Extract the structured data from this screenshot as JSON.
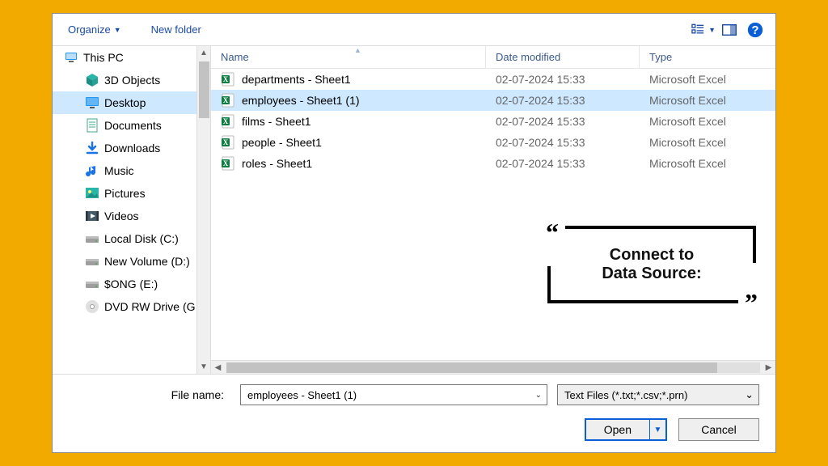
{
  "toolbar": {
    "organize_label": "Organize",
    "newfolder_label": "New folder"
  },
  "tree": {
    "items": [
      {
        "name": "this-pc",
        "label": "This PC",
        "icon": "pc",
        "pad": "root"
      },
      {
        "name": "3d-objects",
        "label": "3D Objects",
        "icon": "cube",
        "pad": "child"
      },
      {
        "name": "desktop",
        "label": "Desktop",
        "icon": "desktop",
        "pad": "child",
        "selected": true
      },
      {
        "name": "documents",
        "label": "Documents",
        "icon": "doc",
        "pad": "child"
      },
      {
        "name": "downloads",
        "label": "Downloads",
        "icon": "download",
        "pad": "child"
      },
      {
        "name": "music",
        "label": "Music",
        "icon": "music",
        "pad": "child"
      },
      {
        "name": "pictures",
        "label": "Pictures",
        "icon": "picture",
        "pad": "child"
      },
      {
        "name": "videos",
        "label": "Videos",
        "icon": "video",
        "pad": "child"
      },
      {
        "name": "local-disk-c",
        "label": "Local Disk (C:)",
        "icon": "drive",
        "pad": "child"
      },
      {
        "name": "new-volume-d",
        "label": "New Volume (D:)",
        "icon": "drive",
        "pad": "child"
      },
      {
        "name": "song-e",
        "label": "$ONG (E:)",
        "icon": "drive",
        "pad": "child"
      },
      {
        "name": "dvd-rw",
        "label": "DVD RW Drive (G",
        "icon": "dvd",
        "pad": "child"
      }
    ]
  },
  "cols": {
    "name": "Name",
    "date": "Date modified",
    "type": "Type"
  },
  "files": [
    {
      "name": "departments - Sheet1",
      "date": "02-07-2024 15:33",
      "type": "Microsoft Excel"
    },
    {
      "name": "employees - Sheet1 (1)",
      "date": "02-07-2024 15:33",
      "type": "Microsoft Excel",
      "selected": true
    },
    {
      "name": "films - Sheet1",
      "date": "02-07-2024 15:33",
      "type": "Microsoft Excel"
    },
    {
      "name": "people - Sheet1",
      "date": "02-07-2024 15:33",
      "type": "Microsoft Excel"
    },
    {
      "name": "roles - Sheet1",
      "date": "02-07-2024 15:33",
      "type": "Microsoft Excel"
    }
  ],
  "bottom": {
    "fn_label": "File name:",
    "fn_value": "employees - Sheet1 (1)",
    "filter_value": "Text Files (*.txt;*.csv;*.prn)",
    "open_label": "Open",
    "cancel_label": "Cancel"
  },
  "callout": {
    "line1": "Connect to",
    "line2": "Data Source:"
  }
}
